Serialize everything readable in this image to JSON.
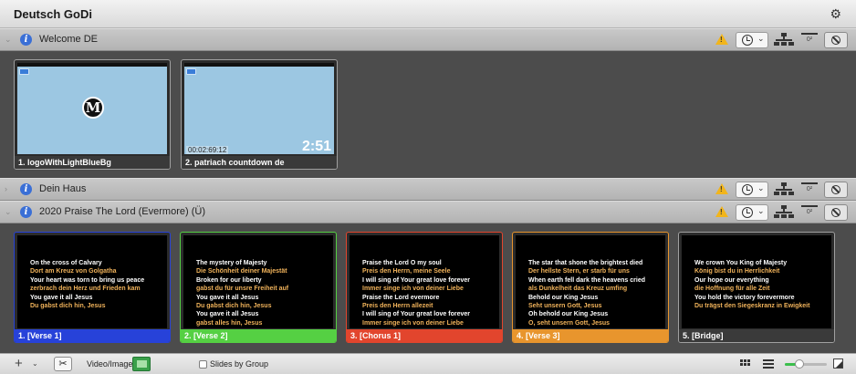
{
  "window": {
    "title": "Deutsch GoDi"
  },
  "groups": [
    {
      "name": "Welcome DE",
      "slides": [
        {
          "label": "1. logoWithLightBlueBg",
          "label_color": "#3a3a3a"
        },
        {
          "label": "2. patriach countdown de",
          "label_color": "#3a3a3a",
          "timecode": "00:02:69:12",
          "countdown": "2:51"
        }
      ]
    },
    {
      "name": "Dein Haus"
    },
    {
      "name": "2020 Praise The Lord (Evermore) (Ü)",
      "slides": [
        {
          "label": "1. [Verse 1]",
          "label_color": "#2742d9",
          "lines": [
            {
              "t": "On the cross of Calvary",
              "c": "w"
            },
            {
              "t": "Dort am Kreuz von Golgatha",
              "c": "y"
            },
            {
              "t": "Your heart was torn to bring us peace",
              "c": "w"
            },
            {
              "t": "zerbrach dein Herz und Frieden kam",
              "c": "y"
            },
            {
              "t": "You gave it all Jesus",
              "c": "w"
            },
            {
              "t": "Du gabst dich hin, Jesus",
              "c": "y"
            }
          ]
        },
        {
          "label": "2. [Verse 2]",
          "label_color": "#55d043",
          "lines": [
            {
              "t": "The mystery of Majesty",
              "c": "w"
            },
            {
              "t": "Die Schönheit deiner Majestät",
              "c": "y"
            },
            {
              "t": "Broken for our liberty",
              "c": "w"
            },
            {
              "t": "gabst du für unsre Freiheit auf",
              "c": "y"
            },
            {
              "t": "You gave it all Jesus",
              "c": "w"
            },
            {
              "t": "Du gabst dich hin, Jesus",
              "c": "y"
            },
            {
              "t": "You gave it all Jesus",
              "c": "w"
            },
            {
              "t": "gabst alles hin, Jesus",
              "c": "y"
            }
          ]
        },
        {
          "label": "3. [Chorus 1]",
          "label_color": "#e2452d",
          "lines": [
            {
              "t": "Praise the Lord O my soul",
              "c": "w"
            },
            {
              "t": "Preis den Herrn, meine Seele",
              "c": "y"
            },
            {
              "t": "I will sing of Your great love forever",
              "c": "w"
            },
            {
              "t": "Immer singe ich von deiner Liebe",
              "c": "y"
            },
            {
              "t": "Praise the Lord evermore",
              "c": "w"
            },
            {
              "t": "Preis den Herrn allezeit",
              "c": "y"
            },
            {
              "t": "I will sing of Your great love forever",
              "c": "w"
            },
            {
              "t": "Immer singe ich von deiner Liebe",
              "c": "y"
            }
          ]
        },
        {
          "label": "4. [Verse 3]",
          "label_color": "#e8952d",
          "lines": [
            {
              "t": "The star that shone the brightest died",
              "c": "w"
            },
            {
              "t": "Der hellste Stern, er starb für uns",
              "c": "y"
            },
            {
              "t": "When earth fell dark the heavens cried",
              "c": "w"
            },
            {
              "t": "als Dunkelheit das Kreuz umfing",
              "c": "y"
            },
            {
              "t": "Behold our King Jesus",
              "c": "w"
            },
            {
              "t": "Seht unsern Gott, Jesus",
              "c": "y"
            },
            {
              "t": "Oh behold our King Jesus",
              "c": "w"
            },
            {
              "t": "O, seht unsern Gott, Jesus",
              "c": "y"
            }
          ]
        },
        {
          "label": "5. [Bridge]",
          "label_color": "#3a3a3a",
          "lines": [
            {
              "t": "We crown You King of Majesty",
              "c": "w"
            },
            {
              "t": "König bist du in Herrlichkeit",
              "c": "y"
            },
            {
              "t": "Our hope our everything",
              "c": "w"
            },
            {
              "t": "die Hoffnung für alle Zeit",
              "c": "y"
            },
            {
              "t": "You hold the victory forevermore",
              "c": "w"
            },
            {
              "t": "Du trägst den Siegeskranz in Ewigkeit",
              "c": "y"
            }
          ]
        }
      ]
    }
  ],
  "toolbar": {
    "plus": "+",
    "video_image_label": "Video/Image",
    "slides_by_group_label": "Slides by Group",
    "slides_by_group_checked": false,
    "zoom_level": 0.35
  },
  "colors": {
    "accent_green": "#3bbf4c",
    "warning": "#f2b51b",
    "info_blue": "#3a6fd6"
  },
  "icons": [
    "gear-icon",
    "info-icon",
    "warning-icon",
    "clock-icon",
    "network-icon",
    "counter-icon",
    "disable-icon",
    "scissors-icon",
    "grid-view-icon",
    "list-view-icon",
    "resize-icon"
  ]
}
